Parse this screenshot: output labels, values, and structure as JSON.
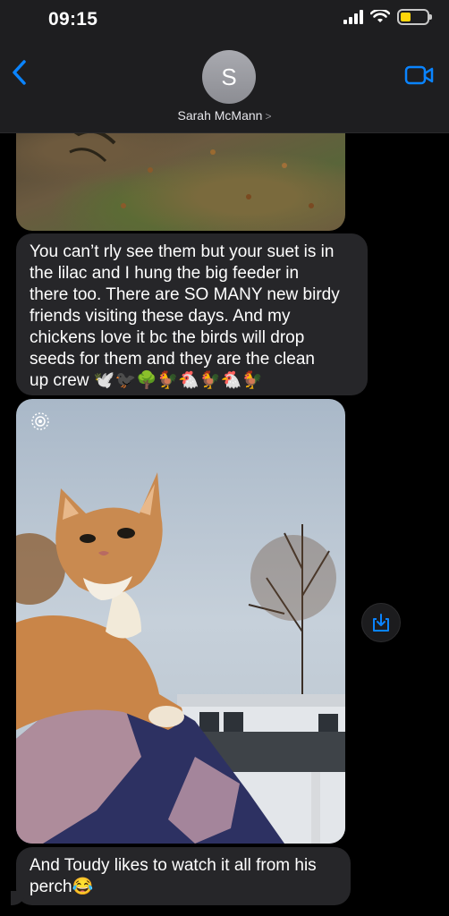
{
  "status_bar": {
    "time": "09:15"
  },
  "header": {
    "avatar_initial": "S",
    "contact_name": "Sarah McMann",
    "chevron": ">"
  },
  "messages": [
    {
      "type": "image",
      "description_icon": "image-icon"
    },
    {
      "type": "text",
      "lines": [
        "You can’t rly see them but your suet is in",
        "the lilac and I hung the big feeder in",
        "there too. There are SO MANY new birdy",
        "friends visiting these days. And my",
        "chickens love it bc the birds will drop",
        "seeds for them and they are the clean",
        "up crew 🕊️🐦‍⬛🌳🐓🐔🐓🐔🐓"
      ]
    },
    {
      "type": "image",
      "description_icon": "image-icon"
    },
    {
      "type": "text",
      "lines": [
        "And Toudy likes to watch it all from his",
        "perch😂"
      ]
    }
  ],
  "colors": {
    "accent": "#0a84ff",
    "bubble": "#262629",
    "background": "#000000"
  },
  "icons": [
    "back-chevron-icon",
    "video-call-icon",
    "signal-icon",
    "wifi-icon",
    "battery-icon",
    "live-photo-icon",
    "save-icon"
  ]
}
